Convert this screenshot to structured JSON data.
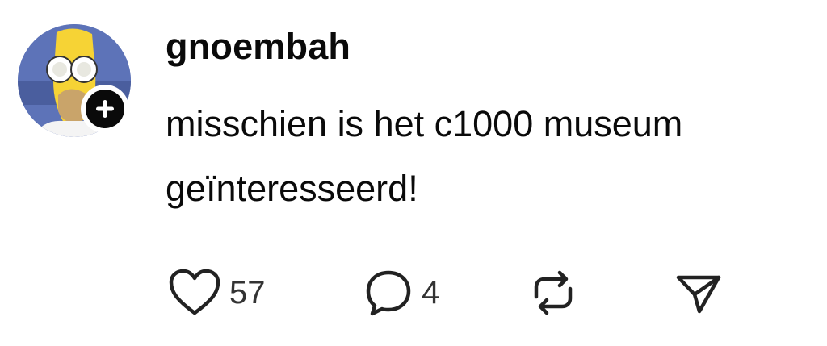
{
  "post": {
    "username": "gnoembah",
    "text": "misschien is het c1000 museum geïnteresseerd!",
    "avatar_icon": "homer-simpson-avatar",
    "follow_icon": "plus-icon"
  },
  "actions": {
    "likes": {
      "icon": "heart-icon",
      "count": "57"
    },
    "replies": {
      "icon": "comment-icon",
      "count": "4"
    },
    "repost": {
      "icon": "repost-icon"
    },
    "share": {
      "icon": "send-icon"
    }
  },
  "colors": {
    "text": "#0a0a0a",
    "icon": "#222222",
    "badge": "#0a0a0a",
    "background": "#ffffff"
  }
}
